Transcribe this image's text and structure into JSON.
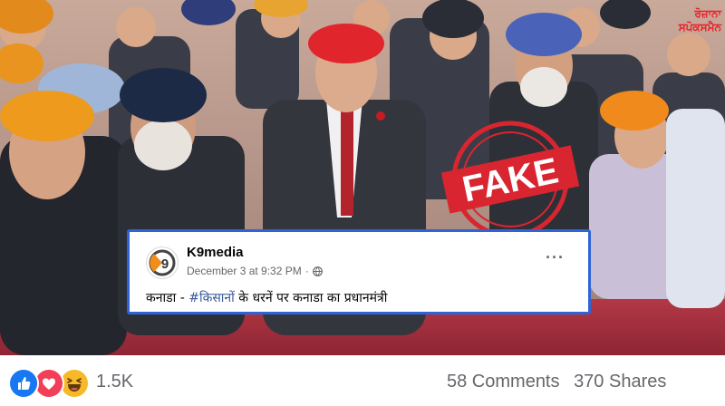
{
  "watermark_logo": {
    "line1": "ਰੋਜ਼ਾਨਾ",
    "line2": "ਸਪੋਕਸਮੈਨ"
  },
  "stamp": {
    "text": "FAKE",
    "color": "#d92530"
  },
  "post": {
    "page_name": "K9media",
    "timestamp": "December 3 at 9:32 PM",
    "separator": "·",
    "more_icon": "···",
    "text_before": "कनाडा - ",
    "hashtag": "#किसानों",
    "text_after": " के धरनें पर कनाडा का प्रधानमंत्री",
    "avatar_letter": "9"
  },
  "footer": {
    "reaction_icons": [
      "like-icon",
      "love-icon",
      "haha-icon"
    ],
    "reaction_count": "1.5K",
    "comments": "58 Comments",
    "shares": "370 Shares"
  },
  "colors": {
    "highlight_border": "#2f64d8",
    "stamp_red": "#d92530",
    "logo_red": "#e8232a",
    "meta_gray": "#65676b"
  }
}
